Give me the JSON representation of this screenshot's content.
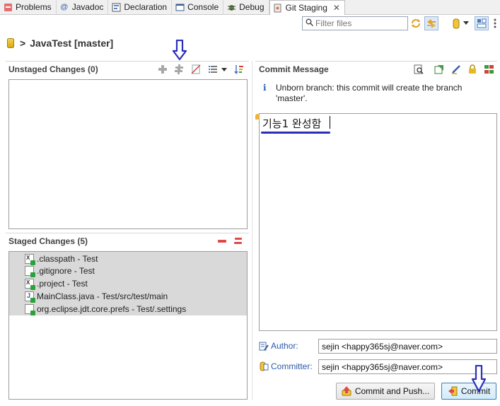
{
  "tabs": [
    {
      "label": "Problems",
      "icon": "problems-icon"
    },
    {
      "label": "Javadoc",
      "icon": "javadoc-icon"
    },
    {
      "label": "Declaration",
      "icon": "declaration-icon"
    },
    {
      "label": "Console",
      "icon": "console-icon"
    },
    {
      "label": "Debug",
      "icon": "debug-icon"
    },
    {
      "label": "Git Staging",
      "icon": "git-staging-icon",
      "active": true
    }
  ],
  "filter": {
    "placeholder": "Filter files"
  },
  "repo": {
    "title": "JavaTest [master]"
  },
  "unstaged": {
    "title": "Unstaged Changes (0)",
    "items": []
  },
  "staged": {
    "title": "Staged Changes (5)",
    "items": [
      {
        "label": ".classpath - Test",
        "icon": "xml-file-icon"
      },
      {
        "label": ".gitignore - Test",
        "icon": "text-file-icon"
      },
      {
        "label": ".project - Test",
        "icon": "xml-file-icon"
      },
      {
        "label": "MainClass.java - Test/src/test/main",
        "icon": "java-file-icon"
      },
      {
        "label": "org.eclipse.jdt.core.prefs - Test/.settings",
        "icon": "text-file-icon"
      }
    ]
  },
  "commit": {
    "title": "Commit Message",
    "info": "Unborn branch: this commit will create the branch 'master'.",
    "message": "기능1  완성함",
    "author_label": "Author:",
    "author_value": "sejin <happy365sj@naver.com>",
    "committer_label": "Committer:",
    "committer_value": "sejin <happy365sj@naver.com>",
    "commit_push_label": "Commit and Push...",
    "commit_label": "Commit"
  },
  "colors": {
    "annotation_blue": "#2a2fb8",
    "link_blue": "#2c5aa8",
    "staged_bg": "#d9d9d9"
  }
}
